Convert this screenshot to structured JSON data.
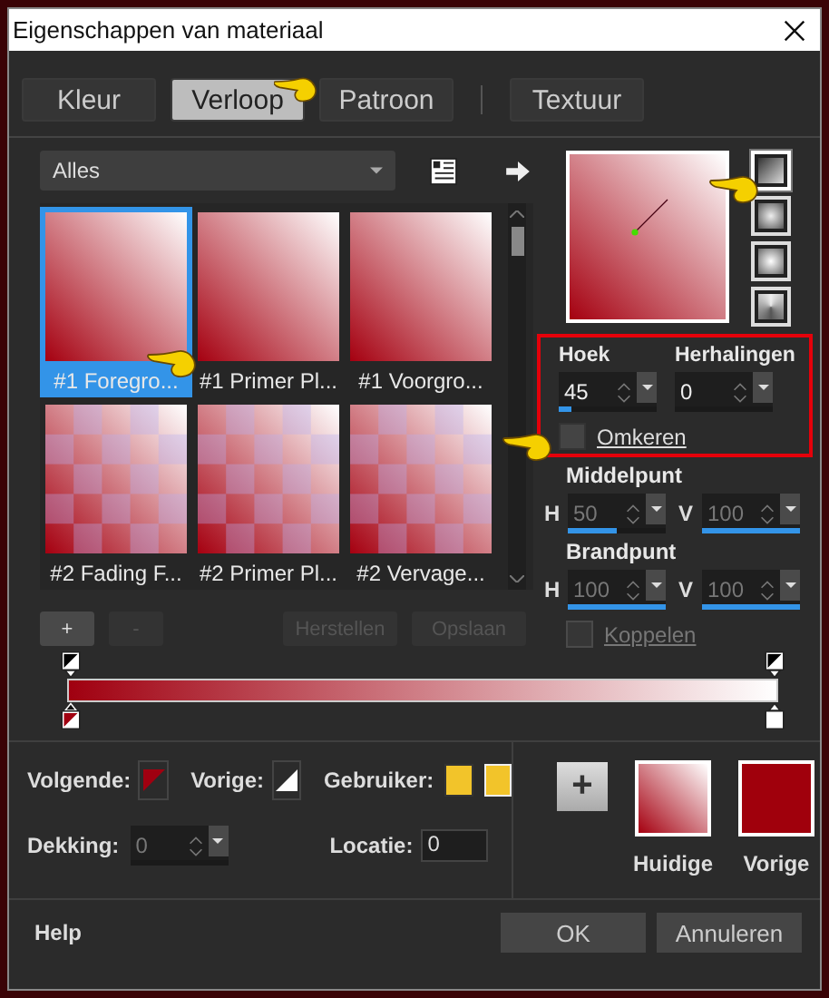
{
  "window": {
    "title": "Eigenschappen van materiaal"
  },
  "tabs": [
    {
      "label": "Kleur",
      "selected": false
    },
    {
      "label": "Verloop",
      "selected": true
    },
    {
      "label": "Patroon",
      "selected": false
    },
    {
      "label": "Textuur",
      "selected": false
    }
  ],
  "gradient_picker": {
    "category": "Alles",
    "swatches": [
      {
        "label": "#1 Foregro...",
        "kind": "solid",
        "selected": true
      },
      {
        "label": "#1 Primer Pl...",
        "kind": "solid",
        "selected": false
      },
      {
        "label": "#1 Voorgro...",
        "kind": "solid",
        "selected": false
      },
      {
        "label": "#2 Fading F...",
        "kind": "fading",
        "selected": false
      },
      {
        "label": "#2 Primer Pl...",
        "kind": "fading",
        "selected": false
      },
      {
        "label": "#2 Vervage...",
        "kind": "fading",
        "selected": false
      }
    ]
  },
  "style_buttons": [
    {
      "kind": "linear",
      "selected": true
    },
    {
      "kind": "rectangular",
      "selected": false
    },
    {
      "kind": "sunburst",
      "selected": false
    },
    {
      "kind": "radial",
      "selected": false
    }
  ],
  "angle": {
    "label": "Hoek",
    "value": "45",
    "level": 0.125,
    "disabled": false
  },
  "repeats": {
    "label": "Herhalingen",
    "value": "0",
    "disabled": false
  },
  "invert": {
    "label": "Omkeren",
    "checked": false
  },
  "center": {
    "label": "Middelpunt",
    "fields": [
      {
        "axis": "H",
        "value": "50",
        "level": 0.5,
        "disabled": true
      },
      {
        "axis": "V",
        "value": "100",
        "level": 1,
        "disabled": true
      }
    ]
  },
  "focus": {
    "label": "Brandpunt",
    "fields": [
      {
        "axis": "H",
        "value": "100",
        "level": 1,
        "disabled": true
      },
      {
        "axis": "V",
        "value": "100",
        "level": 1,
        "disabled": true
      }
    ]
  },
  "link": {
    "label": "Koppelen",
    "checked": false,
    "disabled": true
  },
  "list_buttons": [
    {
      "label": "+",
      "disabled": false
    },
    {
      "label": "-",
      "disabled": true
    },
    {
      "label": "Herstellen",
      "disabled": true
    },
    {
      "label": "Opslaan",
      "disabled": true
    }
  ],
  "stops": {
    "next_label": "Volgende:",
    "prev_label": "Vorige:",
    "user_label": "Gebruiker:",
    "opacity_label": "Dekking:",
    "opacity_value": "0",
    "location_label": "Locatie:",
    "location_value": "0"
  },
  "materials": {
    "add_label": "+",
    "current_label": "Huidige",
    "previous_label": "Vorige"
  },
  "footer": {
    "help": "Help",
    "ok": "OK",
    "cancel": "Annuleren"
  }
}
